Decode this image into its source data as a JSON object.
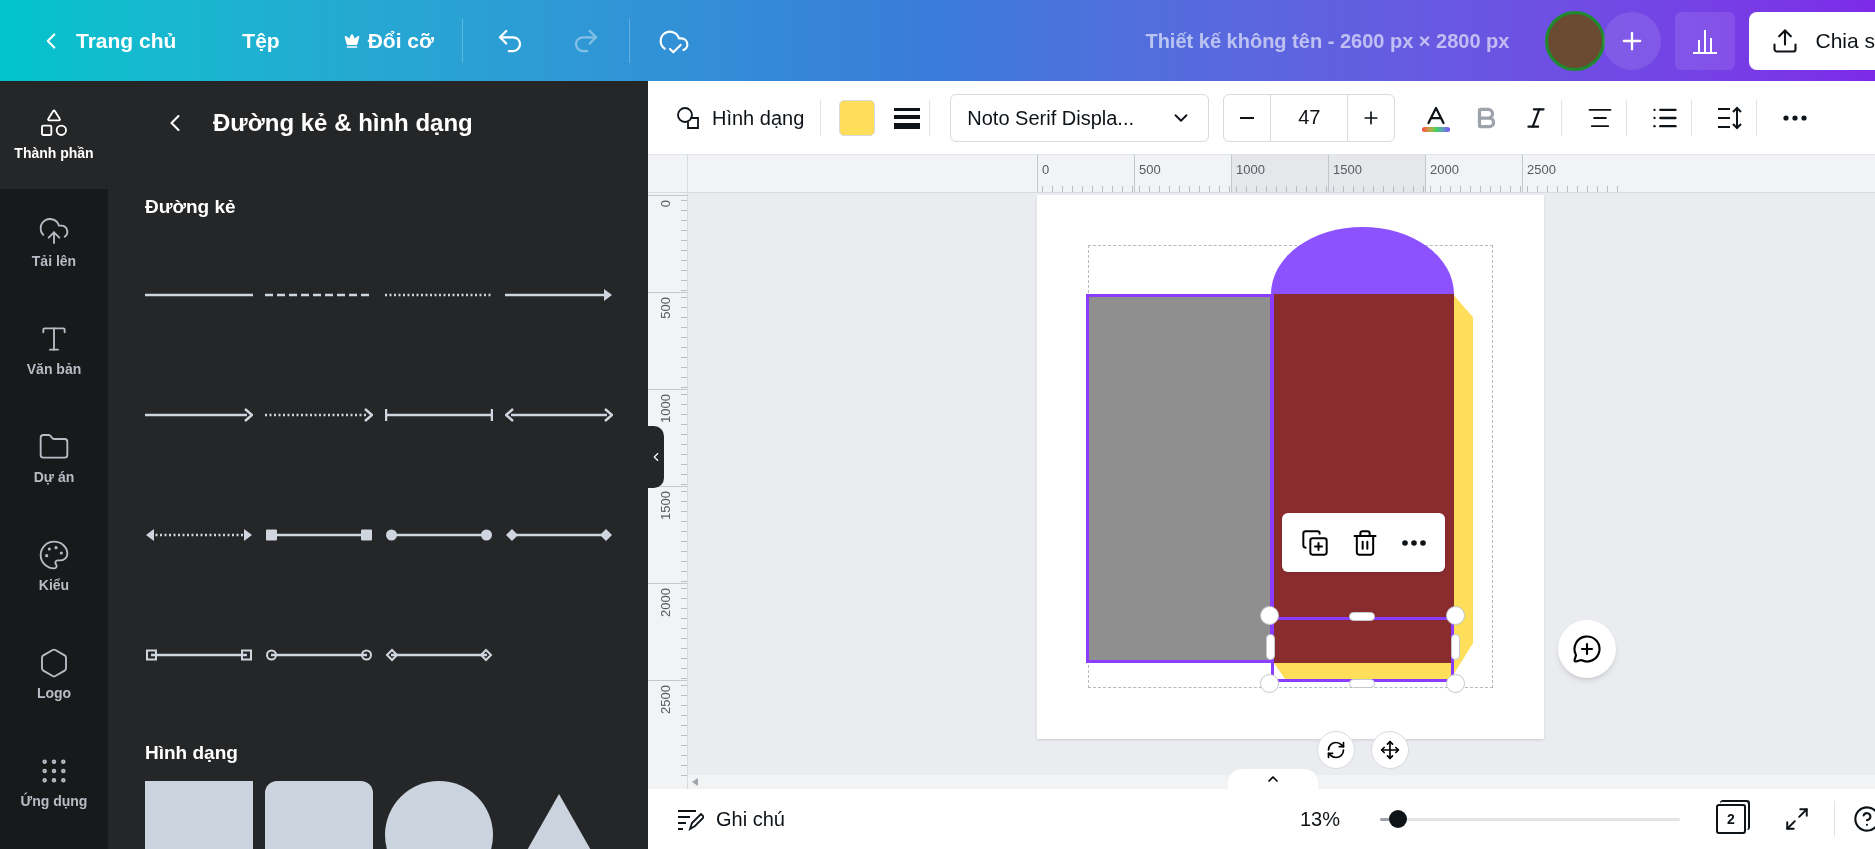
{
  "top_bar": {
    "home": "Trang chủ",
    "file": "Tệp",
    "resize": "Đổi cỡ",
    "undo": {
      "disabled": false
    },
    "redo": {
      "disabled": true
    },
    "title": "Thiết kế không tên - 2600 px × 2800 px",
    "share": "Chia s"
  },
  "sidebar": {
    "items": [
      {
        "label": "Thành phần",
        "selected": true
      },
      {
        "label": "Tải lên",
        "selected": false
      },
      {
        "label": "Văn bản",
        "selected": false
      },
      {
        "label": "Dự án",
        "selected": false
      },
      {
        "label": "Kiểu",
        "selected": false
      },
      {
        "label": "Logo",
        "selected": false
      },
      {
        "label": "Ứng dụng",
        "selected": false
      }
    ]
  },
  "panel": {
    "title": "Đường kẻ & hình dạng",
    "lines_heading": "Đường kẻ",
    "lines": [
      {
        "kind": "solid"
      },
      {
        "kind": "dashed"
      },
      {
        "kind": "dotted"
      },
      {
        "kind": "arrow"
      },
      {
        "kind": "open-arrow"
      },
      {
        "kind": "dotted-arrow"
      },
      {
        "kind": "bar-ends"
      },
      {
        "kind": "double-arrow"
      },
      {
        "kind": "dotted-double-arrow"
      },
      {
        "kind": "square-ends"
      },
      {
        "kind": "circle-ends"
      },
      {
        "kind": "diamond-ends"
      },
      {
        "kind": "square-outline-ends"
      },
      {
        "kind": "circle-outline-ends"
      },
      {
        "kind": "diamond-outline-ends"
      }
    ],
    "shapes_heading": "Hình dạng",
    "shapes": [
      {
        "kind": "square"
      },
      {
        "kind": "rounded-square"
      },
      {
        "kind": "circle"
      },
      {
        "kind": "triangle"
      }
    ]
  },
  "toolbar": {
    "shape_label": "Hình dạng",
    "fill": {
      "color": "#ffde59"
    },
    "font": "Noto Serif Displa...",
    "font_size": "47",
    "bold": {
      "disabled": true
    }
  },
  "ruler": {
    "x_labels": [
      "0",
      "500",
      "1000",
      "1500",
      "2000",
      "2500"
    ],
    "y_labels": [
      "0",
      "500",
      "1000",
      "1500",
      "2000",
      "2500"
    ]
  },
  "bottom_bar": {
    "notes": "Ghi chú",
    "zoom": "13%",
    "zoom_slider": {
      "level": 0.06
    },
    "pages": "2"
  }
}
